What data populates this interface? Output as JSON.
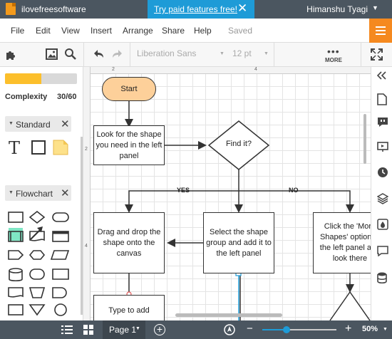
{
  "topbar": {
    "document_title": "ilovefreesoftware",
    "promo_text": "Try paid features free!",
    "promo_close": "✕",
    "user_name": "Himanshu Tyagi",
    "user_dropdown": "▼"
  },
  "menu": {
    "items": [
      "File",
      "Edit",
      "View",
      "Insert",
      "Arrange",
      "Share",
      "Help"
    ],
    "status": "Saved"
  },
  "toolbar": {
    "font_family": "Liberation Sans",
    "font_size": "12 pt",
    "more_label": "MORE",
    "more_dots": "•••"
  },
  "sidebar": {
    "complexity_label": "Complexity",
    "complexity_value": "30/60",
    "complexity_fraction": 0.5,
    "sections": [
      {
        "label": "Standard",
        "close": "✕"
      },
      {
        "label": "Flowchart",
        "close": "✕"
      }
    ],
    "standard_text_shape": "T"
  },
  "canvas": {
    "ruler_top": [
      "2",
      "4"
    ],
    "ruler_left": [
      "2",
      "4"
    ],
    "nodes": {
      "start": "Start",
      "look": "Look for the shape you need in the left panel",
      "find": "Find it?",
      "drag": "Drag and drop the shape onto the canvas",
      "select_group": "Select the shape group and add it to the left panel",
      "click_more": "Click the 'More Shapes' option in the left panel and look there",
      "type_add": "Type to add"
    },
    "edge_labels": {
      "yes": "YES",
      "no": "NO"
    }
  },
  "bottombar": {
    "page_label": "Page 1",
    "page_caret": "▼",
    "add_page": "+",
    "zoom_minus": "−",
    "zoom_plus": "+",
    "zoom_value": "50%",
    "zoom_caret": "▼",
    "zoom_fraction": 0.33
  },
  "colors": {
    "accent": "#1e9bd7",
    "orange": "#f5891f",
    "terminal_fill": "#fdd09a",
    "complexity_fill": "#fcbf2b",
    "dark_bar": "#4b5660"
  }
}
